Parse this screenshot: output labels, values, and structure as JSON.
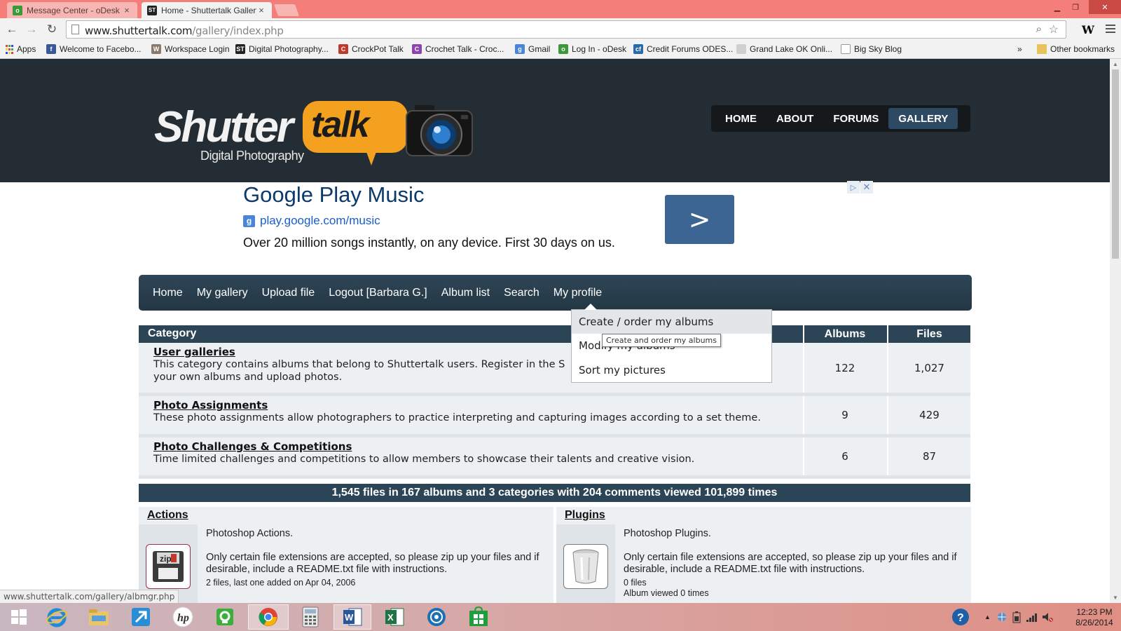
{
  "browser": {
    "tabs": [
      {
        "title": "Message Center - oDesk",
        "active": false
      },
      {
        "title": "Home - Shuttertalk Gallery",
        "active": true
      }
    ],
    "url_host": "www.shuttertalk.com",
    "url_path": "/gallery/index.php",
    "bookmarks_apps_label": "Apps",
    "bookmarks": [
      {
        "label": "Welcome to Facebo...",
        "icon": "facebook-icon",
        "color": "#3b5998",
        "glyph": "f"
      },
      {
        "label": "Workspace Login",
        "icon": "workspace-icon",
        "color": "#8a7a6a",
        "glyph": "W"
      },
      {
        "label": "Digital Photography...",
        "icon": "shuttertalk-icon",
        "color": "#222222",
        "glyph": "ST"
      },
      {
        "label": "CrockPot Talk",
        "icon": "crockpot-icon",
        "color": "#c0392b",
        "glyph": "C"
      },
      {
        "label": "Crochet Talk - Croc...",
        "icon": "crochet-icon",
        "color": "#8e44ad",
        "glyph": "C"
      },
      {
        "label": "Gmail",
        "icon": "google-icon",
        "color": "#4a86d8",
        "glyph": "g"
      },
      {
        "label": "Log In - oDesk",
        "icon": "odesk-icon",
        "color": "#3a9a3a",
        "glyph": "o"
      },
      {
        "label": "Credit Forums ODES...",
        "icon": "credit-icon",
        "color": "#2a6aa8",
        "glyph": "cf"
      },
      {
        "label": "Grand Lake OK Onli...",
        "icon": "page-icon",
        "color": "#d0d0d0",
        "glyph": ""
      },
      {
        "label": "Big Sky Blog",
        "icon": "page-icon",
        "color": "#ffffff",
        "glyph": ""
      }
    ],
    "bookmarks_more": "»",
    "other_bookmarks": "Other bookmarks",
    "status_url": "www.shuttertalk.com/gallery/albmgr.php"
  },
  "site": {
    "logo_word1": "Shutter",
    "logo_word2": "talk",
    "logo_tagline": "Digital Photography",
    "top_nav": [
      {
        "label": "HOME",
        "active": false
      },
      {
        "label": "ABOUT",
        "active": false
      },
      {
        "label": "FORUMS",
        "active": false
      },
      {
        "label": "GALLERY",
        "active": true
      }
    ]
  },
  "ad": {
    "headline": "Google Play Music",
    "url": "play.google.com/music",
    "description": "Over 20 million songs instantly, on any device. First 30 days on us.",
    "go_symbol": ">",
    "adchoices_symbol": "▷",
    "close_symbol": "✕"
  },
  "gallery_nav": {
    "items": [
      "Home",
      "My gallery",
      "Upload file",
      "Logout [Barbara G.]",
      "Album list",
      "Search",
      "My profile"
    ],
    "dropdown": [
      "Create / order my albums",
      "Modify my albums",
      "Sort my pictures"
    ],
    "tooltip": "Create and order my albums"
  },
  "categories": {
    "headers": {
      "category": "Category",
      "albums": "Albums",
      "files": "Files"
    },
    "rows": [
      {
        "name": "User galleries",
        "desc": "This category contains albums that belong to Shuttertalk users. Register in the S",
        "desc2": "your own albums and upload photos.",
        "albums": "122",
        "files": "1,027"
      },
      {
        "name": "Photo Assignments",
        "desc": "These photo assignments allow photographers to practice interpreting and capturing images according to a set theme.",
        "desc2": "",
        "albums": "9",
        "files": "429"
      },
      {
        "name": "Photo Challenges & Competitions",
        "desc": "Time limited challenges and competitions to allow members to showcase their talents and creative vision.",
        "desc2": "",
        "albums": "6",
        "files": "87"
      }
    ],
    "stats": "1,545 files in 167 albums and 3 categories with 204 comments viewed 101,899 times"
  },
  "panels": [
    {
      "title": "Actions",
      "desc": "Photoshop Actions.",
      "note": "Only certain file extensions are accepted, so please zip up your files and if desirable, include a README.txt file with instructions.",
      "meta1": "2 files, last one added on Apr 04, 2006",
      "meta2": "",
      "thumb": "zip-file-icon"
    },
    {
      "title": "Plugins",
      "desc": "Photoshop Plugins.",
      "note": "Only certain file extensions are accepted, so please zip up your files and if desirable, include a README.txt file with instructions.",
      "meta1": "0 files",
      "meta2": "Album viewed 0 times",
      "thumb": "empty-album-icon"
    }
  ],
  "taskbar": {
    "clock_time": "12:23 PM",
    "clock_date": "8/26/2014"
  }
}
